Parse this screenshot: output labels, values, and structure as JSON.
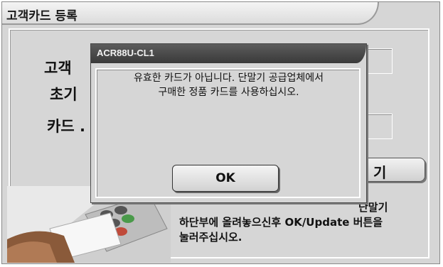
{
  "window": {
    "title": "고객카드 등록"
  },
  "form": {
    "label_customer": "고객",
    "label_init": "초기",
    "label_card": "카드 ."
  },
  "right_button": {
    "label": "기"
  },
  "instructions": {
    "lines": [
      "단말기",
      "하단부에 올려놓으신후 OK/Update 버튼을",
      "눌러주십시오."
    ]
  },
  "dialog": {
    "title": "ACR88U-CL1",
    "message_line1": "유효한 카드가 아닙니다. 단말기 공급업체에서",
    "message_line2": "구매한 정품 카드를 사용하십시오.",
    "ok_label": "OK"
  }
}
